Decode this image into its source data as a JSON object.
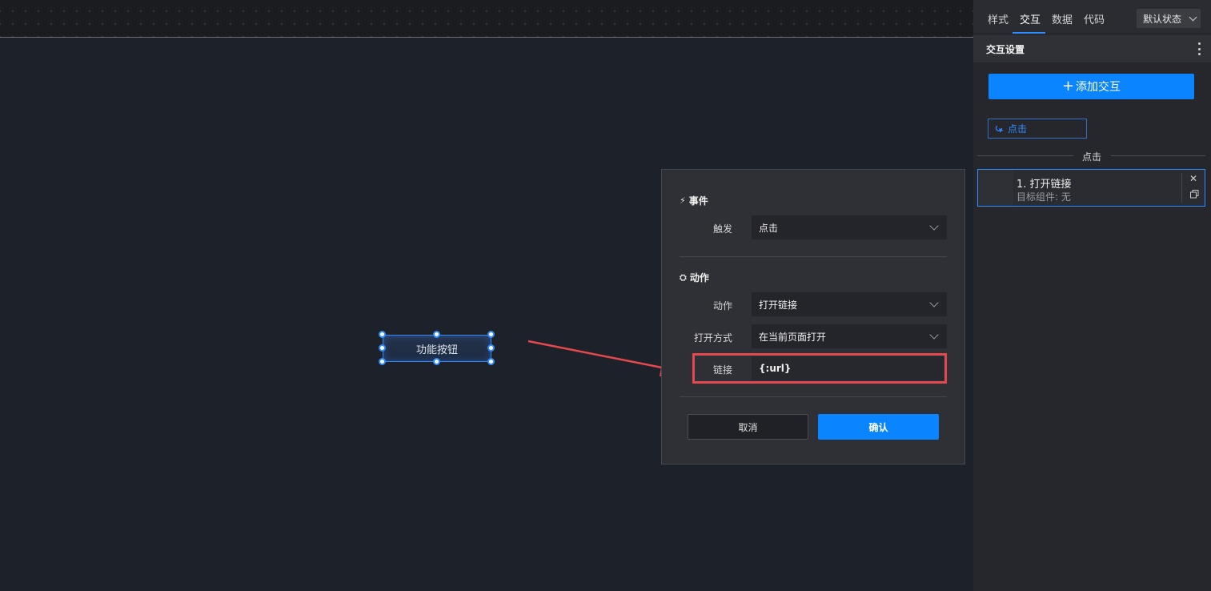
{
  "canvas": {
    "widget_label": "功能按钮"
  },
  "dialog": {
    "event_section": {
      "icon": "lightning-icon",
      "title": "事件"
    },
    "trigger": {
      "label": "触发",
      "value": "点击"
    },
    "action_section": {
      "icon": "action-icon",
      "title": "动作"
    },
    "action": {
      "label": "动作",
      "value": "打开链接"
    },
    "open_mode": {
      "label": "打开方式",
      "value": "在当前页面打开"
    },
    "link": {
      "label": "链接",
      "value": "{:url}"
    },
    "cancel_label": "取消",
    "confirm_label": "确认"
  },
  "panel": {
    "tabs": [
      {
        "label": "样式"
      },
      {
        "label": "交互"
      },
      {
        "label": "数据"
      },
      {
        "label": "代码"
      }
    ],
    "active_tab": "交互",
    "state_select": "默认状态",
    "section_title": "交互设置",
    "add_button": {
      "icon": "plus-icon",
      "label": "添加交互"
    },
    "event_chip": {
      "icon": "pointer-click-icon",
      "label": "点击"
    },
    "group_label": "点击",
    "action_card": {
      "title": "1. 打开链接",
      "subtitle": "目标组件: 无"
    }
  },
  "colors": {
    "accent": "#0a84ff",
    "highlight": "#e5484d",
    "canvas_bg": "#1d2129",
    "panel_bg": "#25272c"
  }
}
